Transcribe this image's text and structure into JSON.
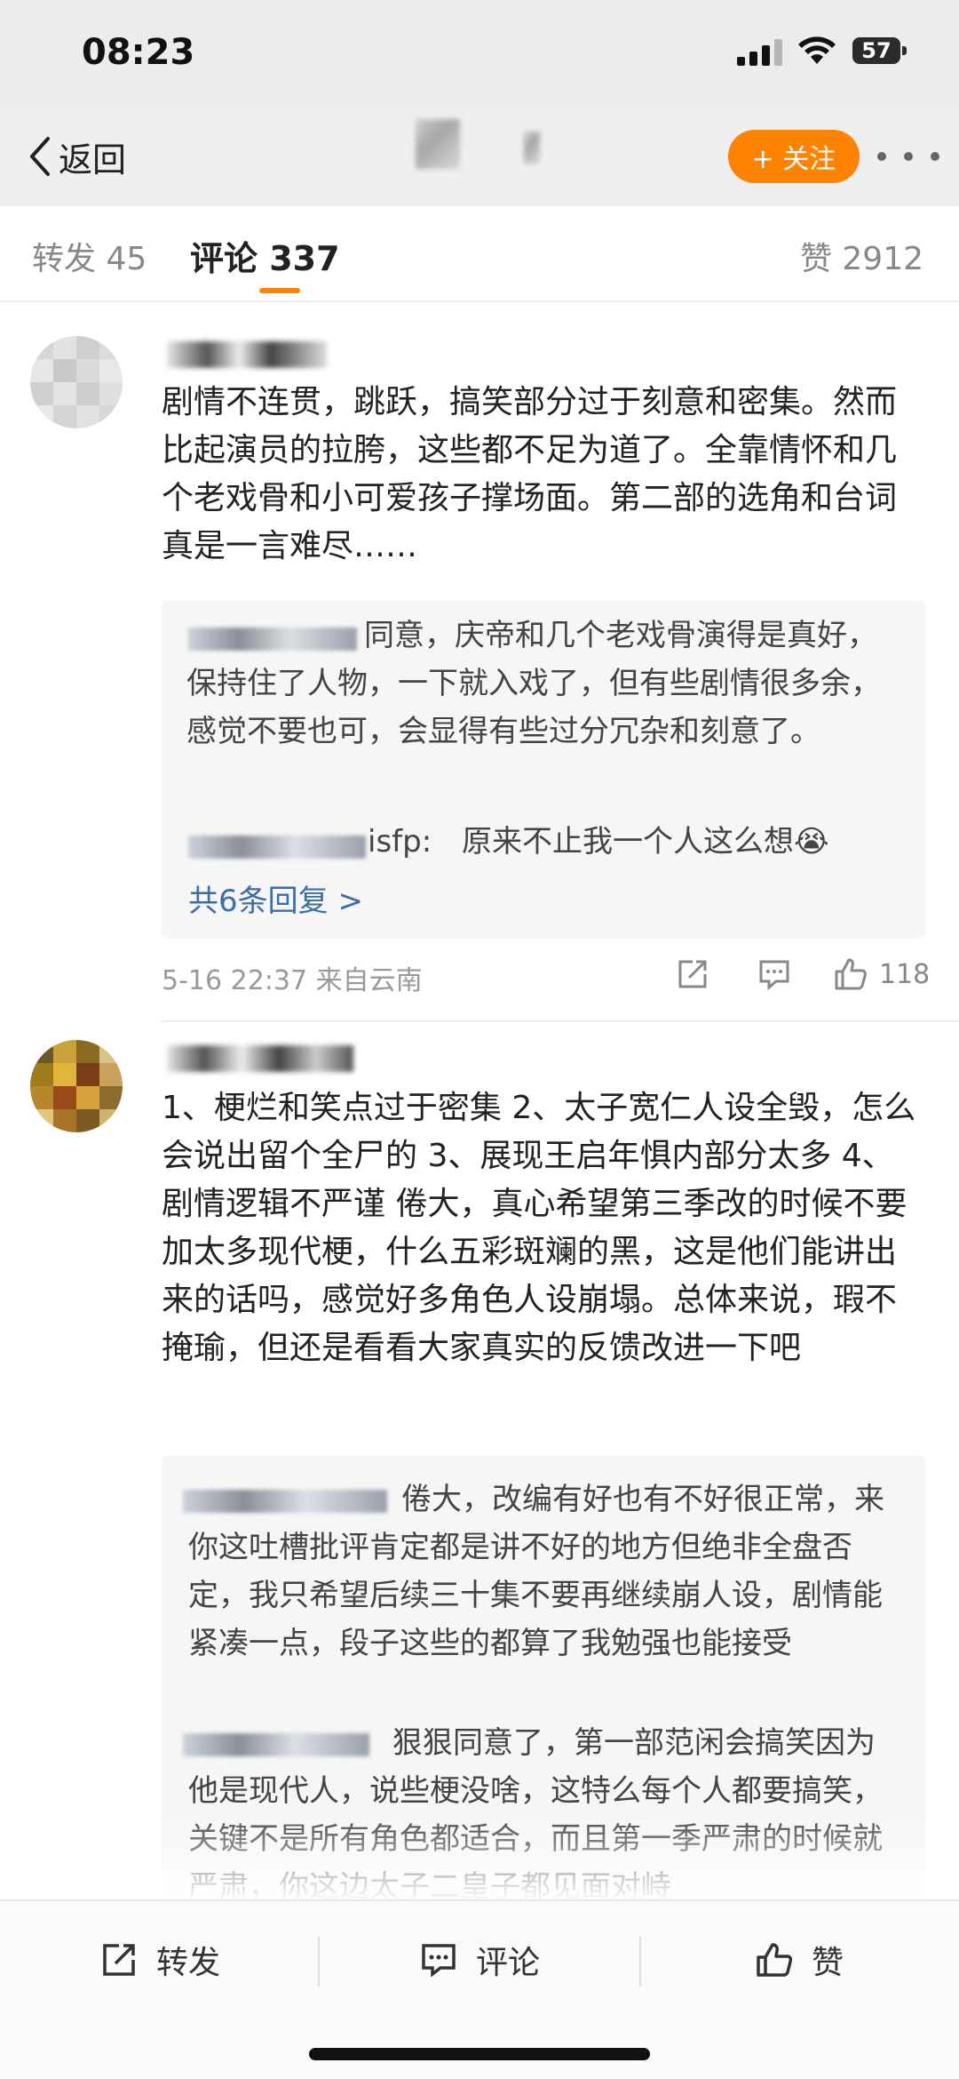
{
  "status_bar": {
    "time": "08:23",
    "battery": "57"
  },
  "header": {
    "back_label": "返回",
    "follow_label": "+ 关注"
  },
  "tabs": {
    "repost": "转发 45",
    "comment": "评论 337",
    "likes": "赞 2912"
  },
  "comments": [
    {
      "text": "剧情不连贯，跳跃，搞笑部分过于刻意和密集。然而比起演员的拉胯，这些都不足为道了。全靠情怀和几个老戏骨和小可爱孩子撑场面。第二部的选角和台词真是一言难尽……",
      "replies": [
        {
          "text": "同意，庆帝和几个老戏骨演得是真好，保持住了人物，一下就入戏了，但有些剧情很多余，感觉不要也可，会显得有些过分冗杂和刻意了。"
        },
        {
          "name_suffix": "isfp:",
          "text": "原来不止我一个人这么想😭"
        }
      ],
      "more_replies": "共6条回复 >",
      "meta": "5-16 22:37 来自云南",
      "like_count": "118"
    },
    {
      "text": "1、梗烂和笑点过于密集 2、太子宽仁人设全毁，怎么会说出留个全尸的 3、展现王启年惧内部分太多 4、剧情逻辑不严谨 倦大，真心希望第三季改的时候不要加太多现代梗，什么五彩斑斓的黑，这是他们能讲出来的话吗，感觉好多角色人设崩塌。总体来说，瑕不掩瑜，但还是看看大家真实的反馈改进一下吧",
      "replies": [
        {
          "text": "倦大，改编有好也有不好很正常，来你这吐槽批评肯定都是讲不好的地方但绝非全盘否定，我只希望后续三十集不要再继续崩人设，剧情能紧凑一点，段子这些的都算了我勉强也能接受"
        },
        {
          "text": "狠狠同意了，第一部范闲会搞笑因为他是现代人，说些梗没啥，这特么每个人都要搞笑，关键不是所有角色都适合，而且第一季严肃的时候就严肃，你这边太子二皇子都见面对峙"
        }
      ]
    }
  ],
  "toolbar": {
    "repost": "转发",
    "comment": "评论",
    "like": "赞"
  },
  "colors": {
    "accent": "#ff8200",
    "link": "#3a6ea8"
  }
}
